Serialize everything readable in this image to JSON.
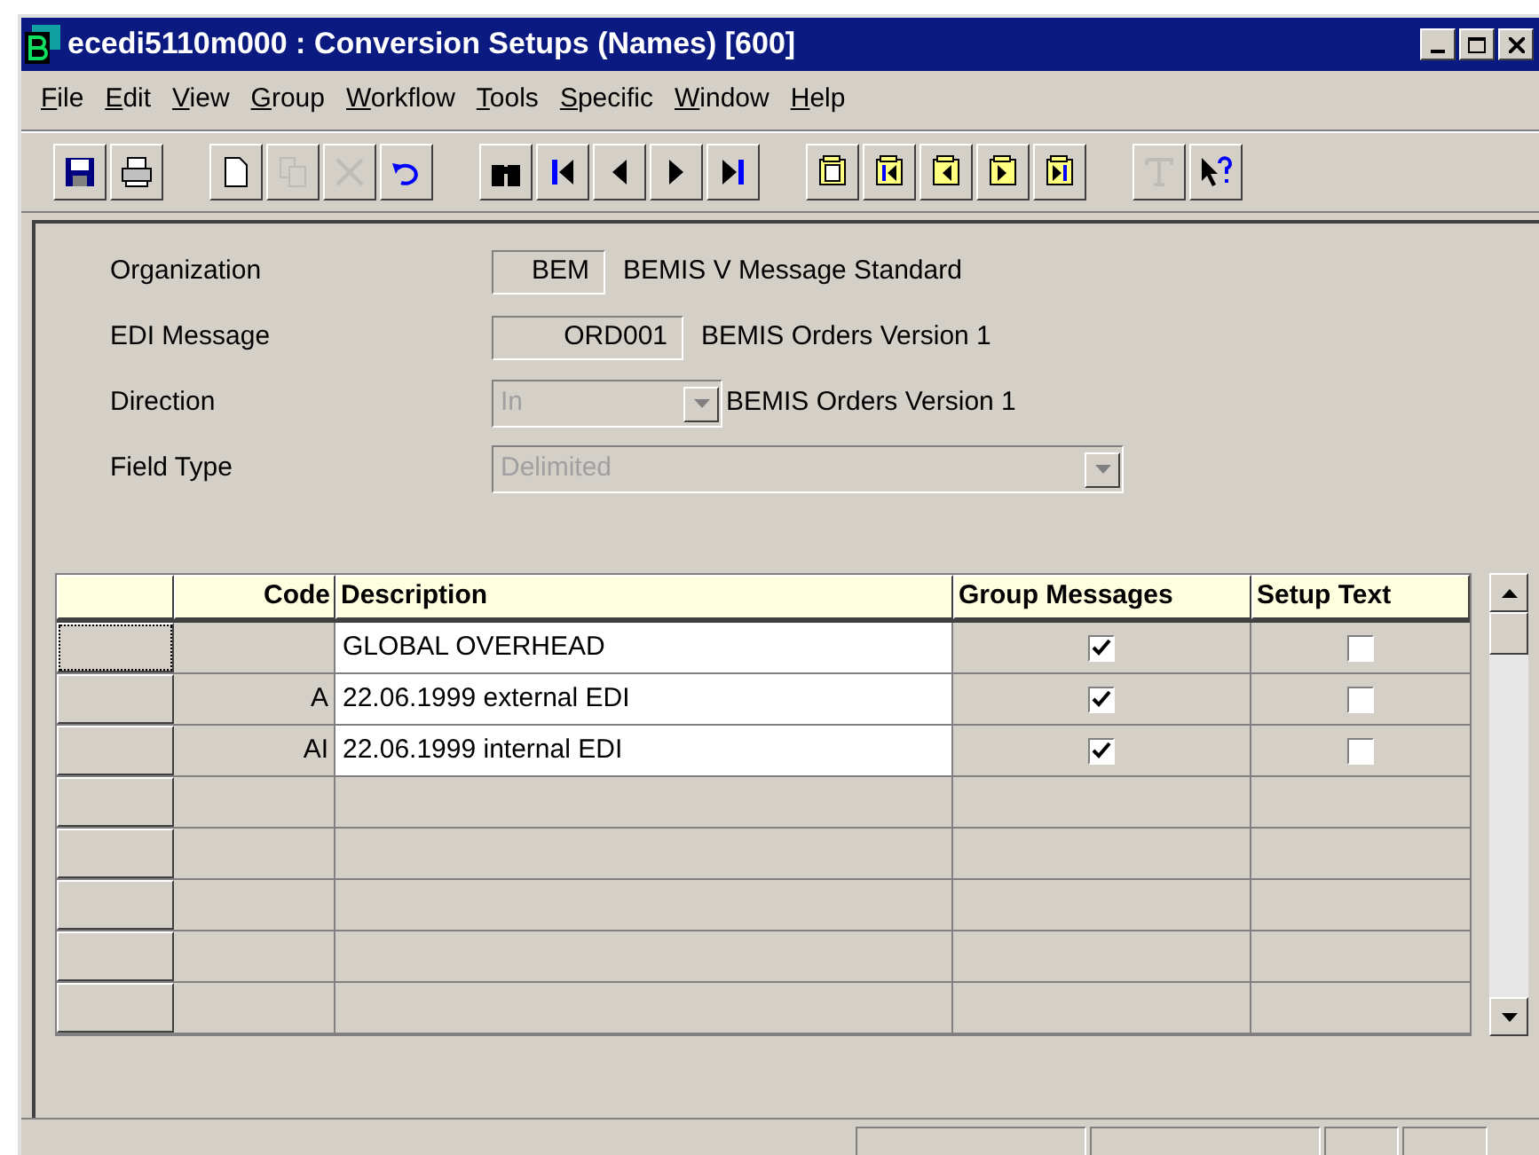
{
  "window": {
    "title": "ecedi5110m000 : Conversion Setups (Names) [600]"
  },
  "menu": [
    "File",
    "Edit",
    "View",
    "Group",
    "Workflow",
    "Tools",
    "Specific",
    "Window",
    "Help"
  ],
  "toolbar": [
    [
      {
        "kind": "save",
        "disabled": false
      },
      {
        "kind": "print",
        "disabled": false
      }
    ],
    [
      {
        "kind": "new",
        "disabled": false
      },
      {
        "kind": "copy",
        "disabled": true
      },
      {
        "kind": "delete",
        "disabled": true
      },
      {
        "kind": "undo",
        "disabled": false
      }
    ],
    [
      {
        "kind": "find",
        "disabled": false
      },
      {
        "kind": "first",
        "disabled": false
      },
      {
        "kind": "prev",
        "disabled": false
      },
      {
        "kind": "next",
        "disabled": false
      },
      {
        "kind": "last",
        "disabled": false
      }
    ],
    [
      {
        "kind": "group",
        "disabled": false
      },
      {
        "kind": "group-first",
        "disabled": false
      },
      {
        "kind": "group-prev",
        "disabled": false
      },
      {
        "kind": "group-next",
        "disabled": false
      },
      {
        "kind": "group-last",
        "disabled": false
      }
    ],
    [
      {
        "kind": "text",
        "disabled": true
      },
      {
        "kind": "help",
        "disabled": false
      }
    ]
  ],
  "form": [
    {
      "kind": "field",
      "label": "Organization",
      "value": "BEM",
      "description": "BEMIS V Message Standard"
    },
    {
      "kind": "field",
      "label": "EDI Message",
      "value": "ORD001",
      "description": "BEMIS Orders Version 1"
    },
    {
      "kind": "combo",
      "label": "Direction",
      "value": "In",
      "description": "BEMIS Orders Version 1",
      "disabled": true
    },
    {
      "kind": "wide-combo",
      "label": "Field Type",
      "value": "Delimited",
      "disabled": true
    }
  ],
  "table": {
    "columns": [
      "Code",
      "Description",
      "Group Messages",
      "Setup Text"
    ],
    "rows": [
      {
        "kind": "data",
        "selected": true,
        "code": "",
        "description": "GLOBAL OVERHEAD",
        "group_messages": true,
        "setup_text": false
      },
      {
        "kind": "data",
        "selected": false,
        "code": "A",
        "description": "22.06.1999 external EDI",
        "group_messages": true,
        "setup_text": false
      },
      {
        "kind": "data",
        "selected": false,
        "code": "AI",
        "description": "22.06.1999 internal EDI",
        "group_messages": true,
        "setup_text": false
      },
      {
        "kind": "empty"
      },
      {
        "kind": "empty"
      },
      {
        "kind": "empty"
      },
      {
        "kind": "empty"
      },
      {
        "kind": "empty"
      }
    ]
  }
}
